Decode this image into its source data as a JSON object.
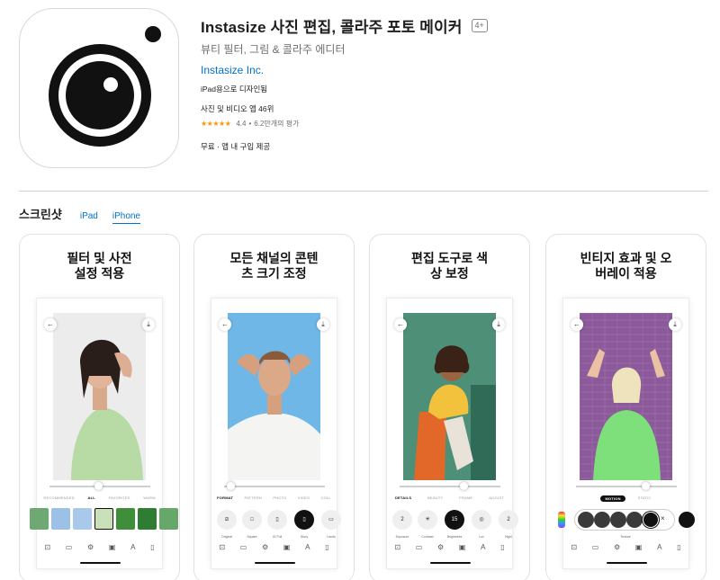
{
  "app": {
    "title": "Instasize 사진 편집, 콜라주 포토 메이커",
    "age_rating": "4+",
    "subtitle": "뷰티 필터, 그림 & 콜라주 에디터",
    "developer": "Instasize Inc.",
    "designed_for": "iPad용으로 디자인됨",
    "rank": "사진 및 비디오 앱 46위",
    "rating": "4.4",
    "rating_count": "6.2만개의 평가",
    "rating_stars": "★★★★★",
    "price": "무료 · 앱 내 구입 제공",
    "icon": "instasize-camera-lens-icon"
  },
  "screenshots": {
    "title": "스크린샷",
    "tabs": [
      {
        "label": "iPad",
        "active": false
      },
      {
        "label": "iPhone",
        "active": true
      }
    ],
    "cards": [
      {
        "title": "필터 및 사전\n설정 적용",
        "menu": [
          "RECOMMENDED",
          "ALL",
          "FAVORITES",
          "WARM"
        ],
        "menu_active": 1,
        "labels": [
          "",
          "",
          "",
          "",
          "",
          ""
        ],
        "slider_value": 0.45
      },
      {
        "title": "모든 채널의 콘텐\n츠 크기 조정",
        "menu": [
          "FORMAT",
          "PATTERN",
          "PHOTO",
          "VIDEO",
          "COLL"
        ],
        "menu_active": 0,
        "labels": [
          "Original",
          "Square",
          "IG Full",
          "Story",
          "Lands"
        ],
        "slider_value": 0.05
      },
      {
        "title": "편집 도구로 색\n상 보정",
        "menu": [
          "DETAILS",
          "BEAUTY",
          "FRAME",
          "ADJUST"
        ],
        "menu_active": 0,
        "labels": [
          "Exposure",
          "Contrast",
          "Brightness",
          "Lux",
          "Highl"
        ],
        "values": [
          "2",
          "",
          "15",
          "",
          "2"
        ],
        "slider_value": 0.6
      },
      {
        "title": "빈티지 효과 및 오\n버레이 적용",
        "menu": [
          "MOTION",
          "STATIC"
        ],
        "menu_active": 0,
        "labels": [
          "Texture"
        ],
        "slider_value": 0.65
      }
    ]
  },
  "colors": {
    "link": "#0070c9",
    "star": "#ff9500"
  }
}
